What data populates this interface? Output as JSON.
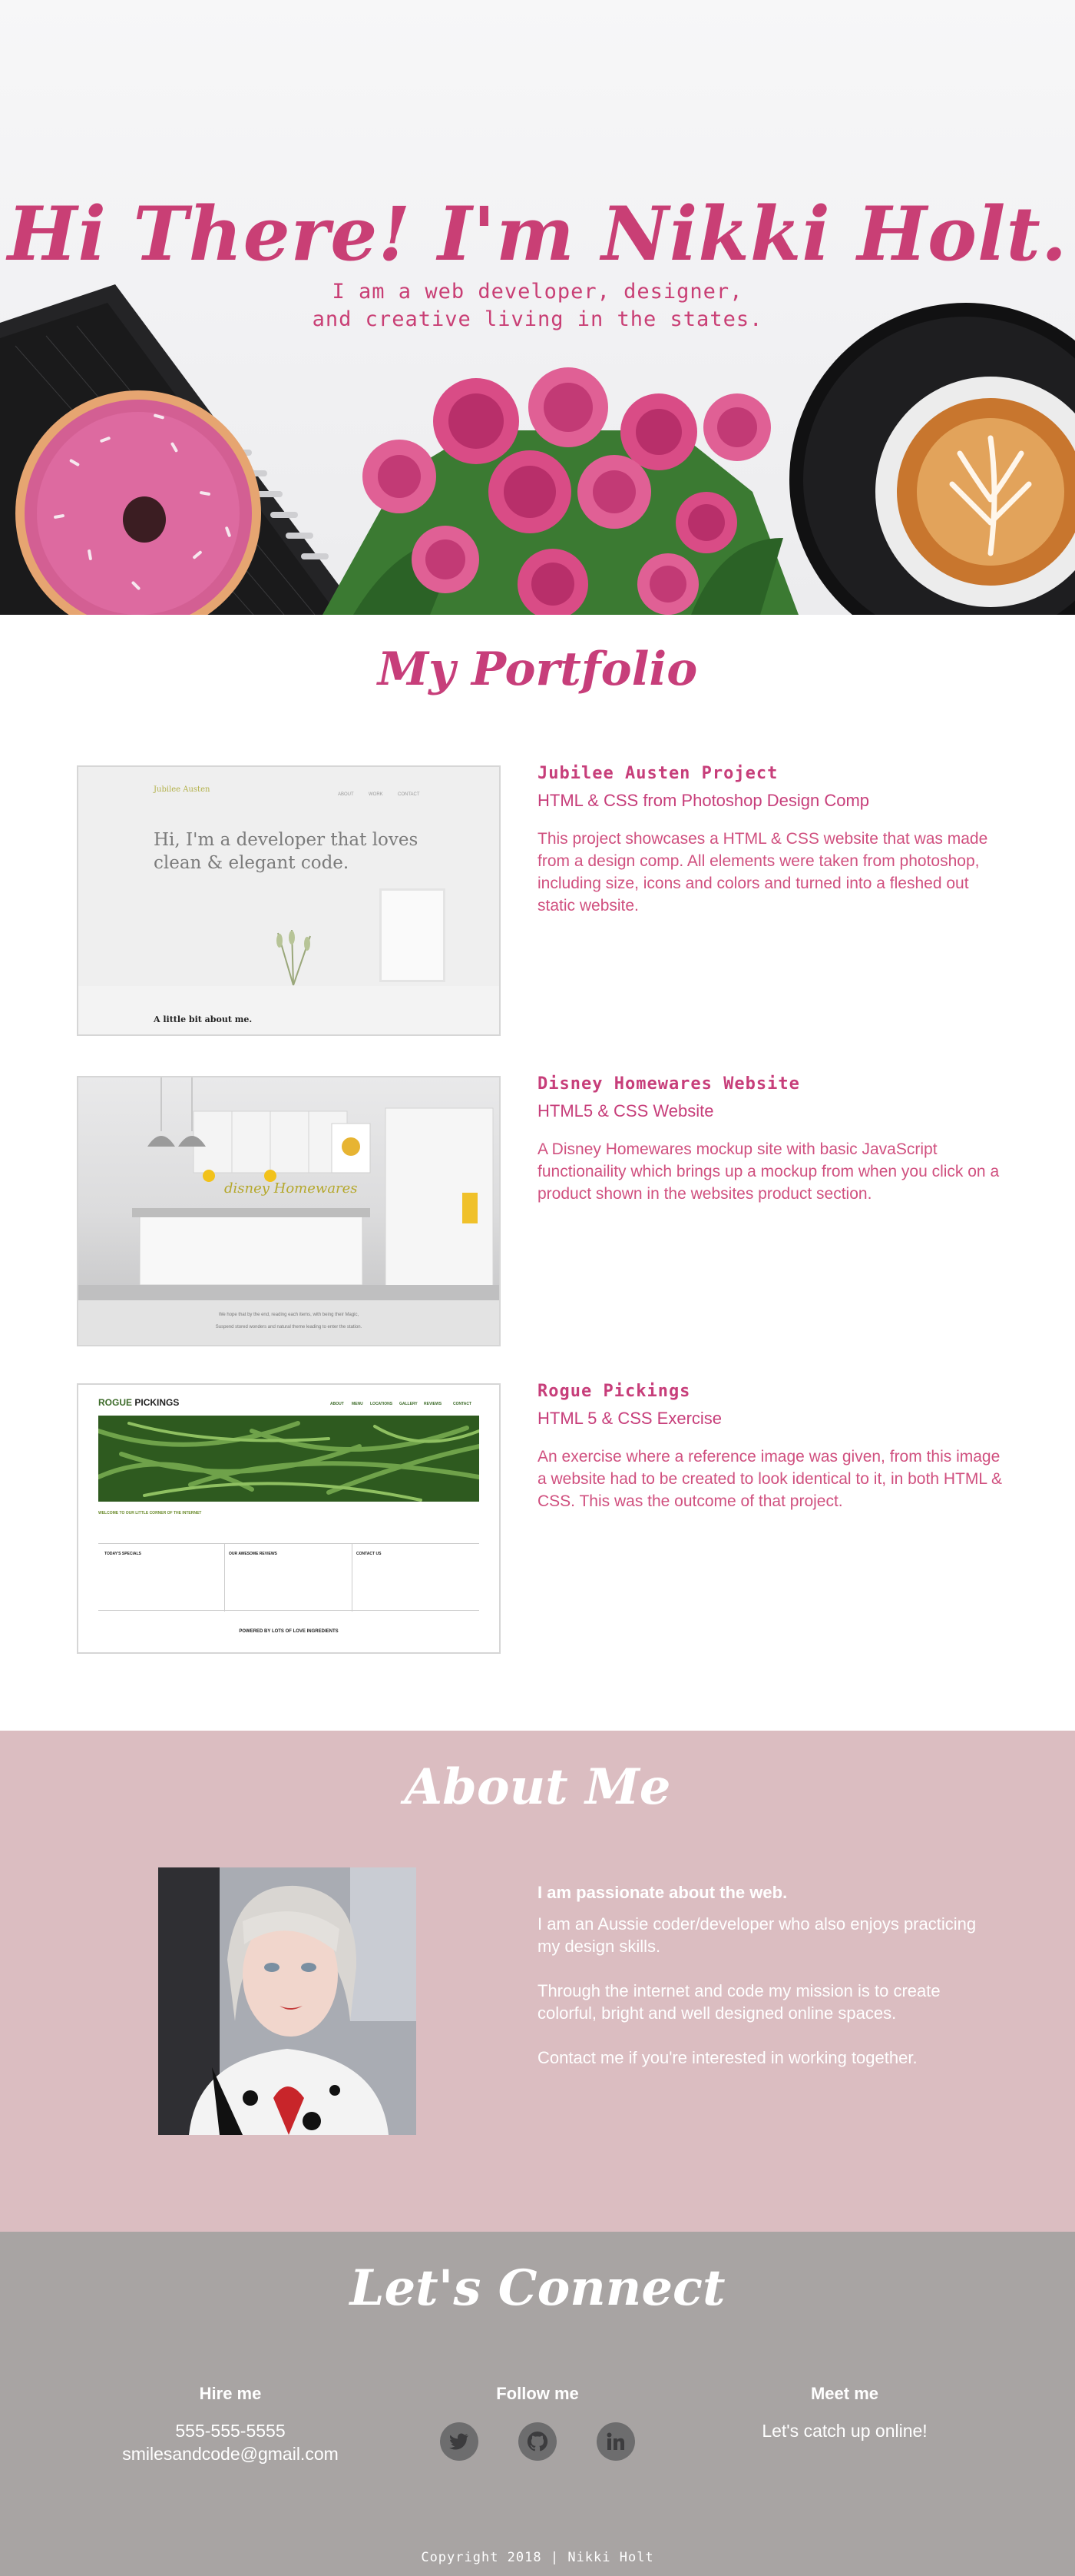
{
  "hero": {
    "title": "Hi There! I'm Nikki Holt.",
    "subtitle_line1": "I am a web developer, designer,",
    "subtitle_line2": "and creative living in the states."
  },
  "portfolio": {
    "heading": "My Portfolio",
    "projects": [
      {
        "title": "Jubilee Austen Project",
        "subtitle": "HTML & CSS from Photoshop Design Comp",
        "description": "This project showcases a HTML & CSS website that was made from a design comp. All elements were taken from photoshop, including size, icons and colors and turned into a fleshed out static website.",
        "thumb": {
          "brand": "Jubilee Austen",
          "nav": [
            "ABOUT",
            "WORK",
            "CONTACT"
          ],
          "headline_line1": "Hi, I'm a developer that loves",
          "headline_line2": "clean & elegant code.",
          "about": "A little bit about me."
        }
      },
      {
        "title": "Disney Homewares Website",
        "subtitle": "HTML5 & CSS Website",
        "description": "A Disney Homewares mockup site with basic JavaScript functionaility which brings up a mockup from when you click on a product shown in the websites product section.",
        "thumb": {
          "logo": "disney Homewares",
          "caption_line1": "We hope that by the end, reading each items, with being their Magic,",
          "caption_line2": "Suspend stored wonders and natural theme leading to enter the station."
        }
      },
      {
        "title": "Rogue Pickings",
        "subtitle": "HTML 5 & CSS Exercise",
        "description": "An exercise where a reference image was given, from this image a website had to be created to look identical to it, in both HTML & CSS. This was the outcome of that project.",
        "thumb": {
          "logo_a": "ROGUE",
          "logo_b": "PICKINGS",
          "nav": [
            "ABOUT",
            "MENU",
            "LOCATIONS",
            "GALLERY",
            "REVIEWS",
            "CONTACT"
          ],
          "welcome": "WELCOME TO OUR LITTLE CORNER OF THE INTERNET",
          "col1": "TODAY'S SPECIALS",
          "col2": "OUR AWESOME REVIEWS",
          "col3": "CONTACT US",
          "footer": "POWERED BY LOTS OF LOVE INGREDIENTS"
        }
      }
    ]
  },
  "about": {
    "heading": "About Me",
    "lead": "I am passionate about the web.",
    "paragraphs": [
      "I am an Aussie coder/developer who also enjoys practicing my design skills.",
      "Through the internet and code my mission is to create colorful, bright and well designed online spaces.",
      "Contact me if you're interested in working together."
    ]
  },
  "connect": {
    "heading": "Let's Connect",
    "hire": {
      "label": "Hire me",
      "phone": "555-555-5555",
      "email": "smilesandcode@gmail.com"
    },
    "follow": {
      "label": "Follow me",
      "icons": [
        "twitter-icon",
        "github-icon",
        "linkedin-icon"
      ]
    },
    "meet": {
      "label": "Meet me",
      "text": "Let's catch up online!"
    },
    "copyright": "Copyright 2018  | Nikki Holt"
  },
  "colors": {
    "accent": "#c93f75",
    "about_bg": "#dbbdc1",
    "connect_bg": "#a8a4a3",
    "icon_bg": "#6d6d6e"
  }
}
